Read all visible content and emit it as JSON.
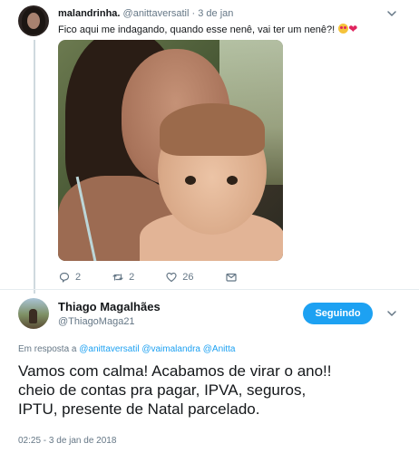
{
  "quoted_tweet": {
    "author_name": "malandrinha.",
    "author_handle": "@anittaversatil",
    "date": "3 de jan",
    "text": "Fico aqui me indagando, quando esse nenê, vai ter um nenê?!",
    "emojis": [
      "heart-eyes-emoji",
      "red-heart-emoji"
    ],
    "actions": {
      "reply_count": "2",
      "retweet_count": "2",
      "like_count": "26"
    }
  },
  "main_tweet": {
    "author_name": "Thiago Magalhães",
    "author_handle": "@ThiagoMaga21",
    "follow_label": "Seguindo",
    "reply_to": {
      "prefix": "Em resposta a",
      "mentions": [
        "@anittaversatil",
        "@vaimalandra",
        "@Anitta"
      ]
    },
    "text_lines": [
      "Vamos com calma! Acabamos de virar o ano!!",
      "cheio de contas pra pagar, IPVA, seguros,",
      "IPTU, presente de Natal parcelado."
    ],
    "timestamp": "02:25 - 3 de jan de 2018"
  },
  "colors": {
    "accent": "#1da1f2",
    "text": "#14171a",
    "muted": "#657786",
    "divider": "#e6ecf0"
  }
}
